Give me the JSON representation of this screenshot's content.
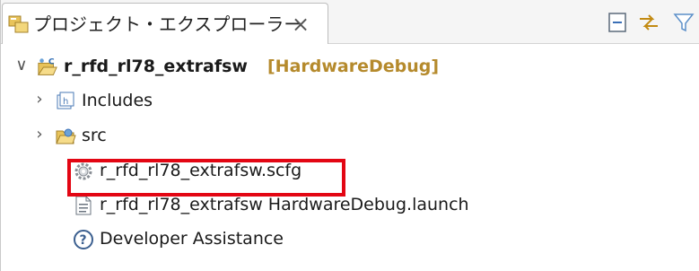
{
  "tab": {
    "title": "プロジェクト・エクスプローラー",
    "close_glyph": "×"
  },
  "tree": {
    "project": {
      "name": "r_rfd_rl78_extrafsw",
      "decoration": "[HardwareDebug]",
      "expanded": true
    },
    "children": [
      {
        "label": "Includes",
        "icon": "includes-icon",
        "expandable": true
      },
      {
        "label": "src",
        "icon": "source-folder-icon",
        "expandable": true
      },
      {
        "label": "r_rfd_rl78_extrafsw.scfg",
        "icon": "gear-config-icon",
        "expandable": false,
        "highlighted": true
      },
      {
        "label": "r_rfd_rl78_extrafsw HardwareDebug.launch",
        "icon": "launch-file-icon",
        "expandable": false
      },
      {
        "label": "Developer Assistance",
        "icon": "help-icon",
        "expandable": false
      }
    ]
  },
  "colors": {
    "highlight": "#e30613",
    "decoration": "#b58a2c"
  }
}
